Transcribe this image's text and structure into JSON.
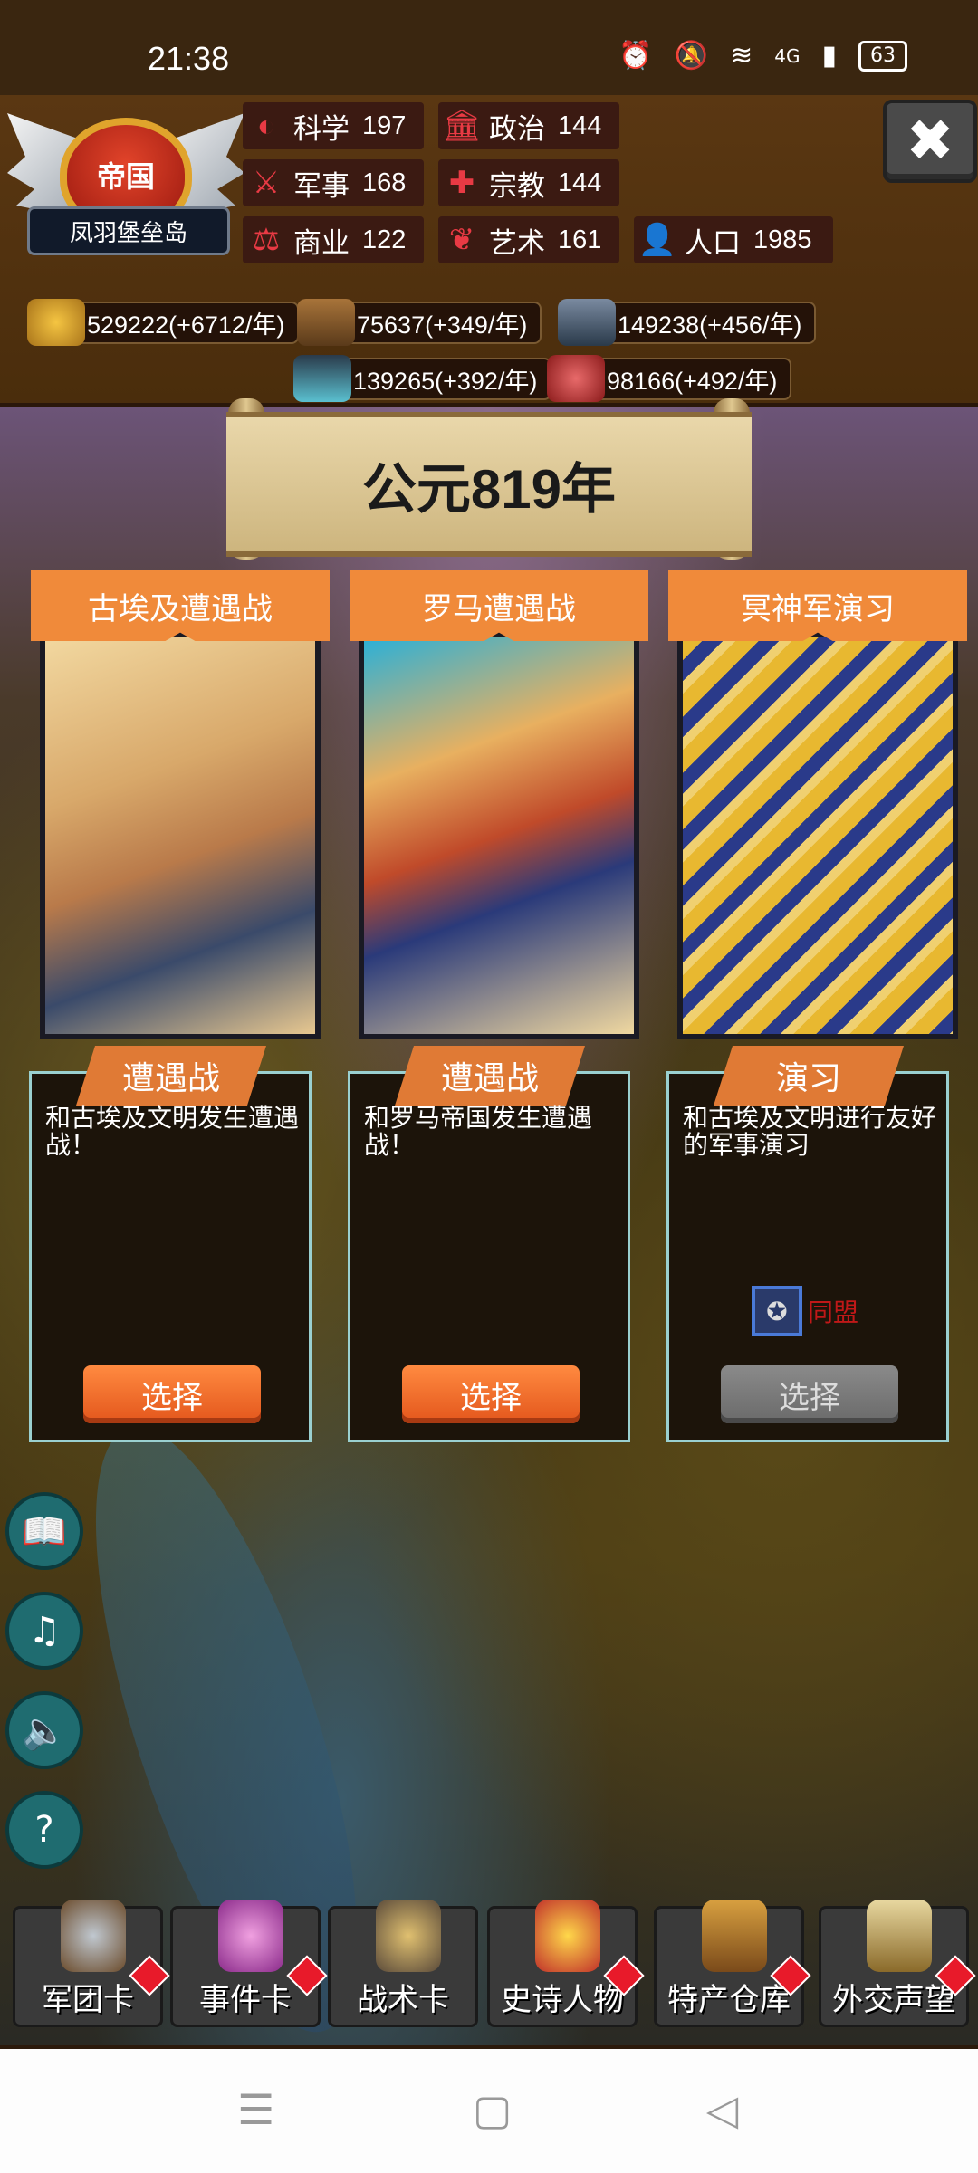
{
  "status_bar": {
    "time": "21:38",
    "battery": "63",
    "signal": "4G"
  },
  "nation": {
    "emblem_text": "帝国",
    "name": "凤羽堡垒岛"
  },
  "stats": [
    {
      "key": "science",
      "icon": "science-icon",
      "label": "科学",
      "value": "197"
    },
    {
      "key": "politics",
      "icon": "politics-icon",
      "label": "政治",
      "value": "144"
    },
    {
      "key": "military",
      "icon": "military-icon",
      "label": "军事",
      "value": "168"
    },
    {
      "key": "religion",
      "icon": "religion-icon",
      "label": "宗教",
      "value": "144"
    },
    {
      "key": "commerce",
      "icon": "commerce-icon",
      "label": "商业",
      "value": "122"
    },
    {
      "key": "art",
      "icon": "art-icon",
      "label": "艺术",
      "value": "161"
    },
    {
      "key": "population",
      "icon": "population-icon",
      "label": "人口",
      "value": "1985"
    }
  ],
  "resources": [
    {
      "icon": "gold-icon",
      "text": "529222(+6712/年)"
    },
    {
      "icon": "wood-icon",
      "text": "75637(+349/年)"
    },
    {
      "icon": "stone-icon",
      "text": "149238(+456/年)"
    },
    {
      "icon": "iron-icon",
      "text": "139265(+392/年)"
    },
    {
      "icon": "meat-icon",
      "text": "98166(+492/年)"
    }
  ],
  "year_banner": "公元819年",
  "cards": [
    {
      "title": "古埃及遭遇战",
      "tag": "遭遇战",
      "desc": "和古埃及文明发生遭遇战！",
      "button": "选择",
      "enabled": true
    },
    {
      "title": "罗马遭遇战",
      "tag": "遭遇战",
      "desc": "和罗马帝国发生遭遇战！",
      "button": "选择",
      "enabled": true
    },
    {
      "title": "冥神军演习",
      "tag": "演习",
      "desc": "和古埃及文明进行友好的军事演习",
      "button": "选择",
      "enabled": false,
      "requirement": "同盟"
    }
  ],
  "bottom_menu": [
    {
      "label": "军团卡",
      "icon": "helmet-icon"
    },
    {
      "label": "事件卡",
      "icon": "scroll-icon"
    },
    {
      "label": "战术卡",
      "icon": "tactics-icon"
    },
    {
      "label": "史诗人物",
      "icon": "crown-icon"
    },
    {
      "label": "特产仓库",
      "icon": "chest-icon"
    },
    {
      "label": "外交声望",
      "icon": "letter-icon"
    }
  ],
  "colors": {
    "accent": "#f08a3a",
    "panel": "#4a2d0c",
    "disabled": "#7a7a7a",
    "alliance_text": "#c01818"
  }
}
